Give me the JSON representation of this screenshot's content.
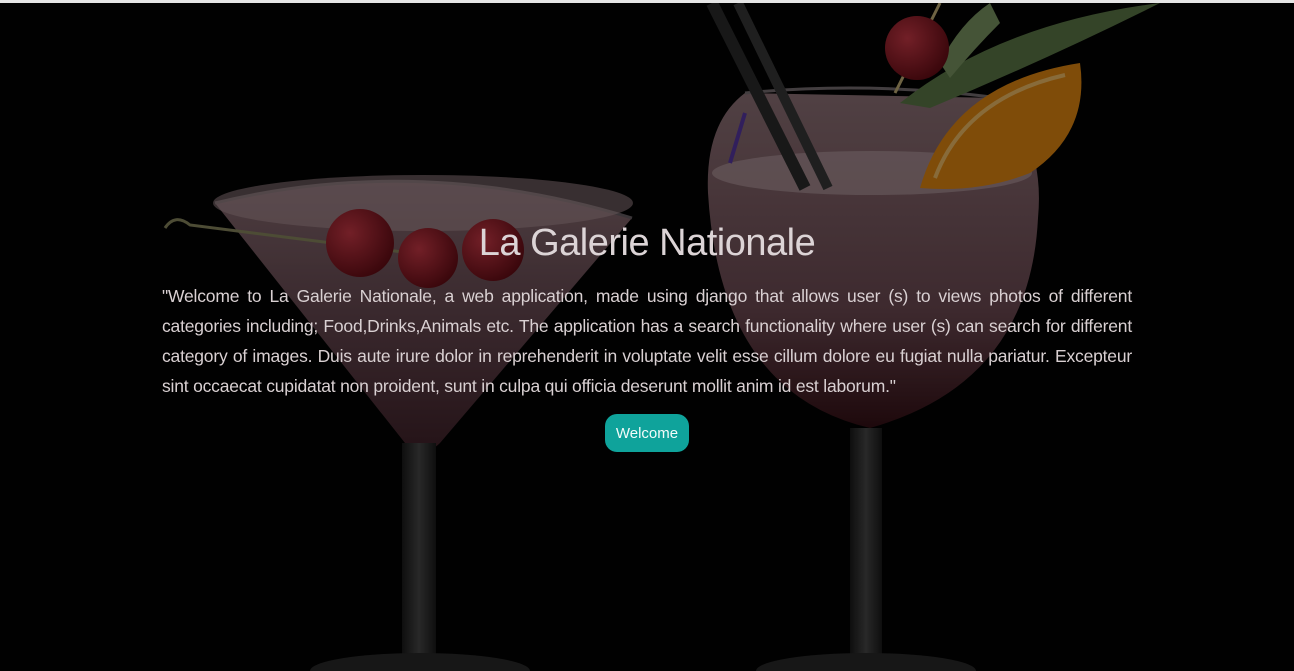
{
  "hero": {
    "title": "La Galerie Nationale",
    "description": "\"Welcome to La Galerie Nationale, a web application, made using django that allows user (s) to views photos of different categories including; Food,Drinks,Animals etc. The application has a search functionality where user (s) can search for different category of images. Duis aute irure dolor in reprehenderit in voluptate velit esse cillum dolore eu fugiat nulla pariatur. Excepteur sint occaecat cupidatat non proident, sunt in culpa qui officia deserunt mollit anim id est laborum.\"",
    "button_label": "Welcome",
    "background_image": "cocktail-glasses-photo"
  },
  "colors": {
    "background": "#000000",
    "accent": "#0fa39b",
    "text": "#dcd4d6"
  }
}
